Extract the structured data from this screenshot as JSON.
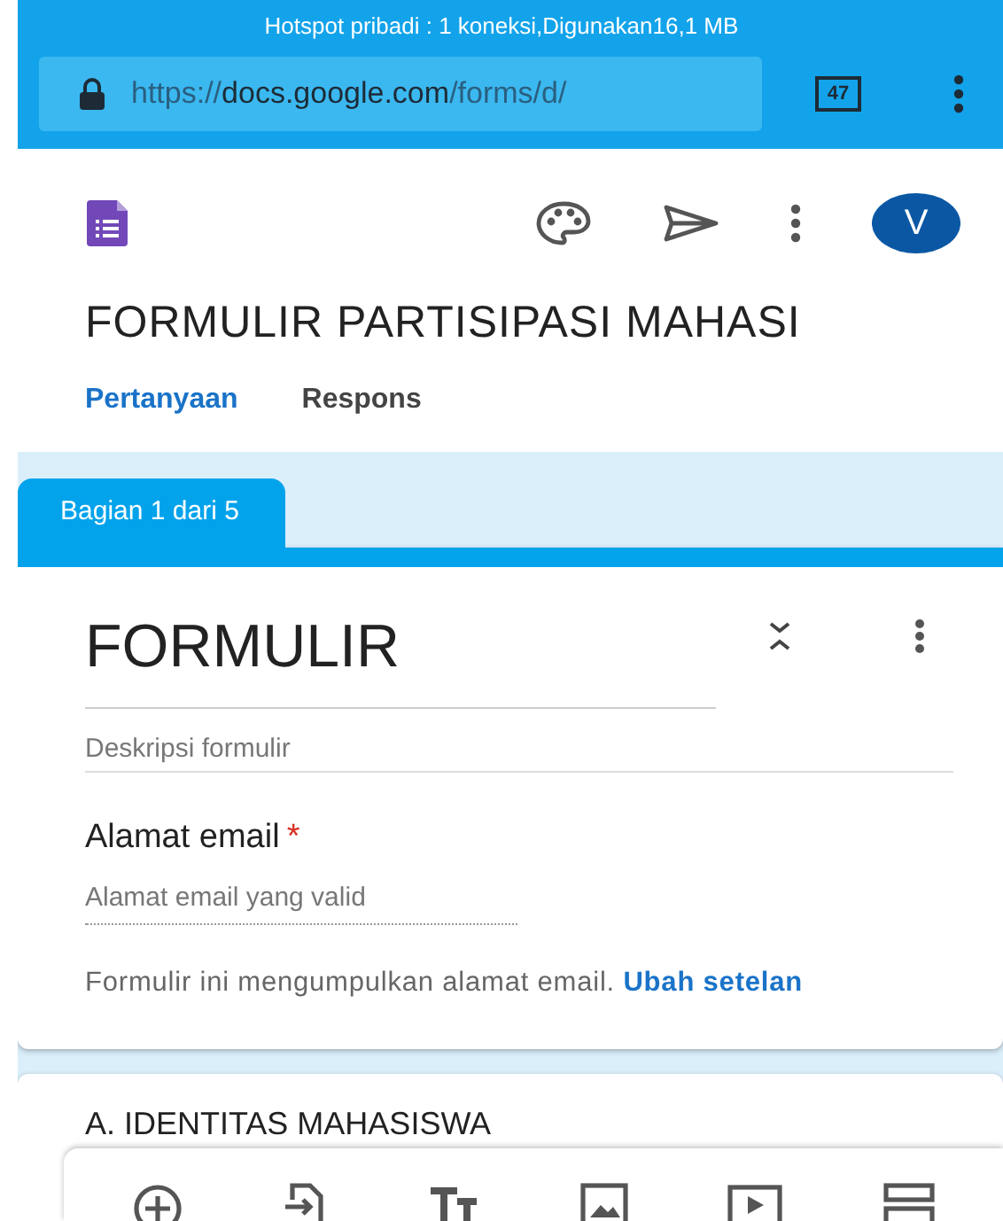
{
  "status_bar": {
    "text": "Hotspot pribadi : 1 koneksi,Digunakan16,1 MB"
  },
  "address_bar": {
    "url_scheme": "https://",
    "url_domain": "docs.google.com",
    "url_path": "/forms/d/",
    "tab_count": "47"
  },
  "header": {
    "avatar": "V",
    "title": "FORMULIR PARTISIPASI MAHASI"
  },
  "tabs": [
    {
      "label": "Pertanyaan",
      "selected": true
    },
    {
      "label": "Respons",
      "selected": false
    }
  ],
  "section_tab": "Bagian 1 dari 5",
  "form_card": {
    "title": "FORMULIR",
    "description_placeholder": "Deskripsi formulir",
    "question": {
      "label": "Alamat email",
      "required": true,
      "required_mark": "*",
      "placeholder": "Alamat email yang valid"
    },
    "notice": "Formulir ini mengumpulkan alamat email.",
    "notice_link": "Ubah setelan"
  },
  "next_section": {
    "title": "A. IDENTITAS MAHASISWA"
  }
}
